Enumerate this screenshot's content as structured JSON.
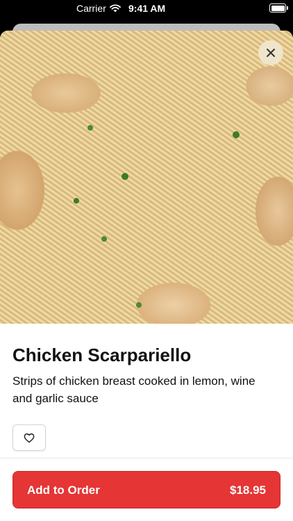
{
  "status_bar": {
    "carrier": "Carrier",
    "time": "9:41 AM",
    "icons": [
      "wifi-icon",
      "battery-icon"
    ]
  },
  "item": {
    "title": "Chicken Scarpariello",
    "description": "Strips of chicken breast cooked in lemon, wine and garlic sauce"
  },
  "actions": {
    "close_icon": "close-icon",
    "favorite_icon": "heart-icon"
  },
  "order": {
    "label": "Add to Order",
    "price": "$18.95",
    "color": "#e53535"
  }
}
